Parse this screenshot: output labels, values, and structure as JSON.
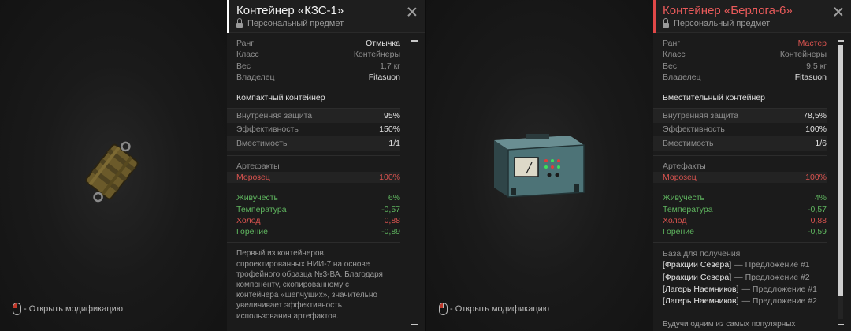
{
  "footer": {
    "mod_label": "- Открыть модификацию"
  },
  "left": {
    "title": "Контейнер «КЗС-1»",
    "subtitle": "Персональный предмет",
    "accent": "#ffffff",
    "stats": [
      {
        "k": "Ранг",
        "v": "Отмычка"
      },
      {
        "k": "Класс",
        "v": "Контейнеры"
      },
      {
        "k": "Вес",
        "v": "1,7 кг"
      },
      {
        "k": "Владелец",
        "v": "Fitasuon"
      }
    ],
    "type_label": "Компактный контейнер",
    "props": [
      {
        "k": "Внутренняя защита",
        "v": "95%"
      },
      {
        "k": "Эффективность",
        "v": "150%"
      },
      {
        "k": "Вместимость",
        "v": "1/1"
      }
    ],
    "artifacts_label": "Артефакты",
    "artifact_row": {
      "k": "Морозец",
      "v": "100%"
    },
    "effects": [
      {
        "k": "Живучесть",
        "v": "6%"
      },
      {
        "k": "Температура",
        "v": "-0,57"
      },
      {
        "k": "Холод",
        "v": "0,88"
      },
      {
        "k": "Горение",
        "v": "-0,89"
      }
    ],
    "description": "Первый из контейнеров, спроектированных НИИ-7 на основе трофейного образца №3-ВА. Благодаря компоненту, скопированному с контейнера «шепчущих», значительно увеличивает эффективность использования артефактов."
  },
  "right": {
    "title": "Контейнер «Берлога-6»",
    "subtitle": "Персональный предмет",
    "accent": "#e04848",
    "stats": [
      {
        "k": "Ранг",
        "v": "Мастер"
      },
      {
        "k": "Класс",
        "v": "Контейнеры"
      },
      {
        "k": "Вес",
        "v": "9,5 кг"
      },
      {
        "k": "Владелец",
        "v": "Fitasuon"
      }
    ],
    "type_label": "Вместительный контейнер",
    "props": [
      {
        "k": "Внутренняя защита",
        "v": "78,5%"
      },
      {
        "k": "Эффективность",
        "v": "100%"
      },
      {
        "k": "Вместимость",
        "v": "1/6"
      }
    ],
    "artifacts_label": "Артефакты",
    "artifact_row": {
      "k": "Морозец",
      "v": "100%"
    },
    "effects": [
      {
        "k": "Живучесть",
        "v": "4%"
      },
      {
        "k": "Температура",
        "v": "-0,57"
      },
      {
        "k": "Холод",
        "v": "0,88"
      },
      {
        "k": "Горение",
        "v": "-0,59"
      }
    ],
    "base_label": "База для получения",
    "base": [
      {
        "faction": "[Фракции Севера]",
        "offer": "— Предложение #1"
      },
      {
        "faction": "[Фракции Севера]",
        "offer": "— Предложение #2"
      },
      {
        "faction": "[Лагерь Наемников]",
        "offer": "— Предложение #1"
      },
      {
        "faction": "[Лагерь Наемников]",
        "offer": "— Предложение #2"
      }
    ],
    "description": "Будучи одним из самых популярных"
  },
  "colors": {
    "rank_master": "#e04848",
    "rank_lockpick": "#e6e6e6",
    "negative": "#d9534f",
    "positive": "#5fb55f"
  }
}
